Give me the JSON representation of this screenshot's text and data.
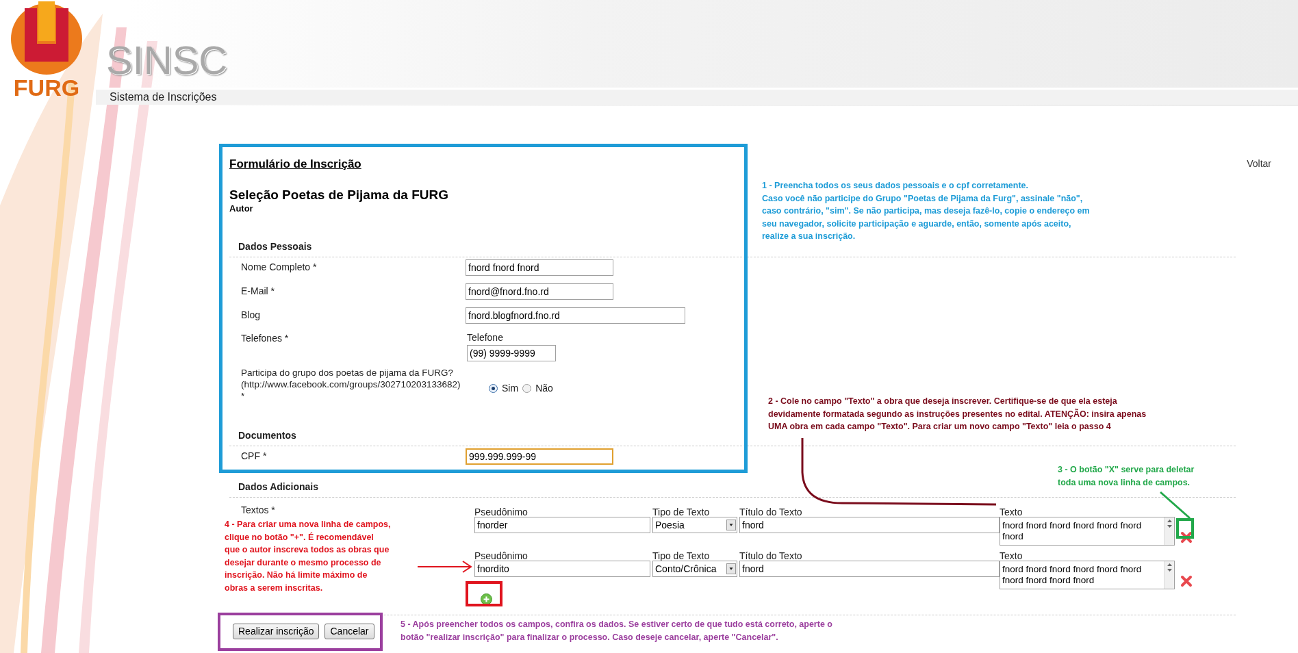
{
  "header": {
    "logo_text": "FURG",
    "app_name": "SINSC",
    "subtitle": "Sistema de Inscrições"
  },
  "back_link": "Voltar",
  "form": {
    "title": "Formulário de Inscrição",
    "subtitle": "Seleção Poetas de Pijama da FURG",
    "role": "Autor",
    "sections": [
      {
        "title": "Dados Pessoais",
        "fields": [
          {
            "kind": "text",
            "label": "Nome Completo *",
            "value": "fnord fnord fnord",
            "focused": false
          },
          {
            "kind": "text",
            "label": "E-Mail *",
            "value": "fnord@fnord.fno.rd",
            "focused": false
          },
          {
            "kind": "wide",
            "label": "Blog",
            "value": "fnord.blogfnord.fno.rd",
            "focused": false
          },
          {
            "kind": "phone",
            "label": "Telefones *",
            "sublabel": "Telefone",
            "value": "(99) 9999-9999",
            "focused": false
          },
          {
            "kind": "radio",
            "label": "Participa do grupo dos poetas de pijama da FURG? (http://www.facebook.com/groups/302710203133682) *",
            "options": [
              {
                "label": "Sim",
                "selected": true
              },
              {
                "label": "Não",
                "selected": false
              }
            ]
          }
        ]
      },
      {
        "title": "Documentos",
        "fields": [
          {
            "kind": "text",
            "label": "CPF *",
            "value": "999.999.999-99",
            "focused": true
          }
        ]
      }
    ]
  },
  "extra": {
    "title": "Dados Adicionais",
    "label": "Textos *",
    "entries": [
      {
        "pseudonym_label": "Pseudônimo",
        "pseudonym": "fnorder",
        "type_label": "Tipo de Texto",
        "type": "Poesia",
        "title_label": "Título do Texto",
        "title": "fnord",
        "text_label": "Texto",
        "text": "fnord fnord fnord fnord fnord fnord\nfnord"
      },
      {
        "pseudonym_label": "Pseudônimo",
        "pseudonym": "fnordito",
        "type_label": "Tipo de Texto",
        "type": "Conto/Crônica",
        "title_label": "Título do Texto",
        "title": "fnord",
        "text_label": "Texto",
        "text": "fnord fnord fnord fnord fnord fnord\nfnord fnord fnord fnord"
      }
    ]
  },
  "buttons": [
    "Realizar inscrição",
    "Cancelar"
  ],
  "annotations": [
    {
      "text": "1 - Preencha todos os seus dados pessoais e o cpf corretamente.\nCaso você não participe do Grupo \"Poetas de Pijama da Furg\", assinale \"não\",\ncaso contrário, \"sim\". Se não participa, mas deseja fazê-lo, copie o endereço em\nseu navegador, solicite participação e aguarde, então, somente após aceito,\nrealize a sua inscrição.",
      "color": "#1e9cd7"
    },
    {
      "text": "2 - Cole no campo \"Texto\" a obra que deseja inscrever. Certifique-se de que ela esteja\ndevidamente formatada segundo as instruções presentes no edital. ATENÇÃO: insira apenas\nUMA obra em cada campo \"Texto\". Para criar um novo campo \"Texto\" leia o passo 4",
      "color": "#7a0c1c"
    },
    {
      "text": "3 - O botão \"X\" serve para deletar\ntoda uma nova linha de campos.",
      "color": "#22a84a"
    },
    {
      "text": "4 - Para criar uma nova linha de campos,\nclique no botão \"+\". É recomendável\nque o autor inscreva todos as obras que\ndesejar durante o mesmo processo de\ninscrição. Não há limite máximo de\nobras a serem inscritas.",
      "color": "#e0141e"
    },
    {
      "text": "5 - Após preencher todos os campos, confira os dados. Se estiver certo de que tudo está correto, aperte o\nbotão \"realizar inscrição\" para finalizar o processo. Caso deseje cancelar, aperte \"Cancelar\".",
      "color": "#9b3f9e"
    }
  ]
}
